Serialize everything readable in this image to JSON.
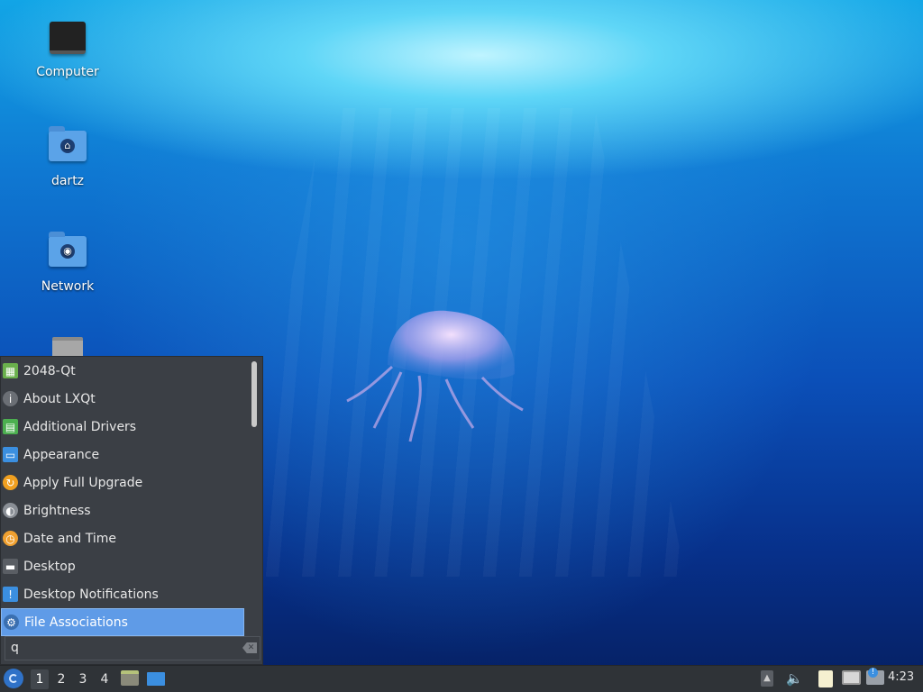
{
  "desktop": {
    "icons": [
      {
        "label": "Computer",
        "icon": "computer-icon"
      },
      {
        "label": "dartz",
        "icon": "home-folder-icon"
      },
      {
        "label": "Network",
        "icon": "network-folder-icon"
      },
      {
        "label": "",
        "icon": "trash-icon"
      }
    ]
  },
  "menu": {
    "items": [
      {
        "label": "2048-Qt",
        "icon": "game-2048-icon",
        "color": "#6ab04c"
      },
      {
        "label": "About LXQt",
        "icon": "info-icon",
        "color": "#6b6f75"
      },
      {
        "label": "Additional Drivers",
        "icon": "chip-icon",
        "color": "#4caf50"
      },
      {
        "label": "Appearance",
        "icon": "appearance-icon",
        "color": "#3b8fe0"
      },
      {
        "label": "Apply Full Upgrade",
        "icon": "upgrade-icon",
        "color": "#f0a020"
      },
      {
        "label": "Brightness",
        "icon": "brightness-icon",
        "color": "#8a8f96"
      },
      {
        "label": "Date and Time",
        "icon": "clock-icon",
        "color": "#f0a030"
      },
      {
        "label": "Desktop",
        "icon": "desktop-icon",
        "color": "#5a5e64"
      },
      {
        "label": "Desktop Notifications",
        "icon": "notification-icon",
        "color": "#3b8fe0"
      },
      {
        "label": "File Associations",
        "icon": "gear-icon",
        "color": "#3a6fb0"
      }
    ],
    "selected_index": 9,
    "search": {
      "value": "q"
    }
  },
  "taskbar": {
    "desktops": [
      "1",
      "2",
      "3",
      "4"
    ],
    "active_desktop": "1",
    "clock": "4:23"
  },
  "colors": {
    "menu_bg": "#3b3f45",
    "selection": "#5f9be7",
    "taskbar_bg": "#2f3337"
  }
}
